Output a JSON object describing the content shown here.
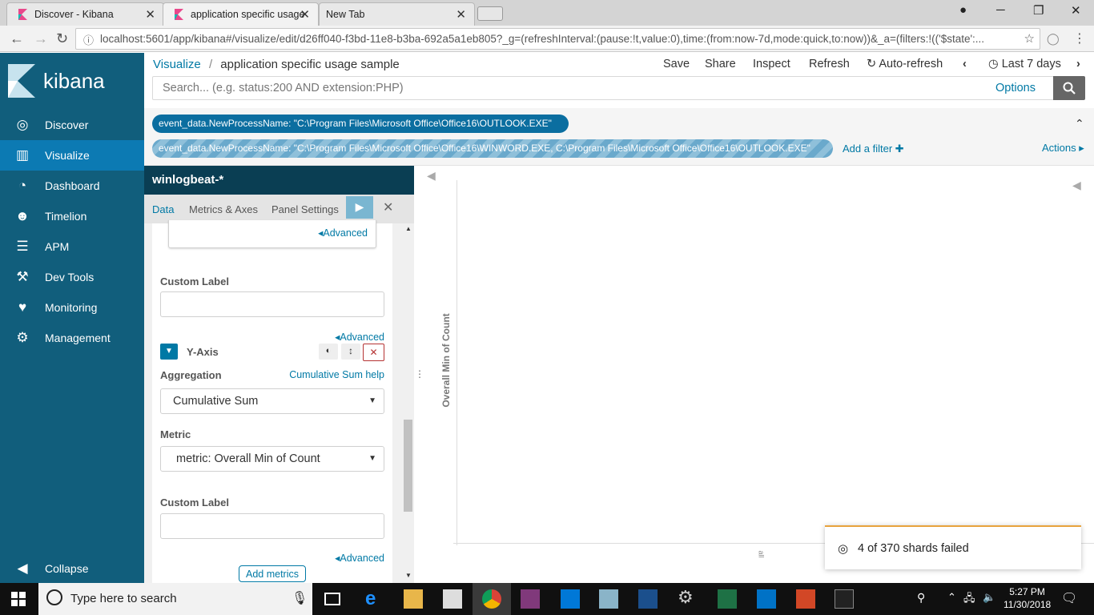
{
  "browser": {
    "tabs": [
      {
        "title": "Discover - Kibana"
      },
      {
        "title": "application specific usage"
      },
      {
        "title": "New Tab"
      }
    ],
    "url": "localhost:5601/app/kibana#/visualize/edit/d26ff040-f3bd-11e8-b3ba-692a5a1eb805?_g=(refreshInterval:(pause:!t,value:0),time:(from:now-7d,mode:quick,to:now))&_a=(filters:!(('$state':..."
  },
  "sidebar": {
    "logo": "kibana",
    "items": [
      {
        "label": "Discover",
        "icon": "compass-icon"
      },
      {
        "label": "Visualize",
        "icon": "bar-chart-icon",
        "active": true
      },
      {
        "label": "Dashboard",
        "icon": "dashboard-icon"
      },
      {
        "label": "Timelion",
        "icon": "timelion-icon"
      },
      {
        "label": "APM",
        "icon": "apm-icon"
      },
      {
        "label": "Dev Tools",
        "icon": "wrench-icon"
      },
      {
        "label": "Monitoring",
        "icon": "heartbeat-icon"
      },
      {
        "label": "Management",
        "icon": "gear-icon"
      }
    ],
    "collapse": "Collapse"
  },
  "header": {
    "crumb_link": "Visualize",
    "crumb_sep": "/",
    "crumb_title": "application specific usage sample",
    "save": "Save",
    "share": "Share",
    "inspect": "Inspect",
    "refresh": "Refresh",
    "auto_refresh": "Auto-refresh",
    "time": "Last 7 days"
  },
  "search": {
    "placeholder": "Search... (e.g. status:200 AND extension:PHP)",
    "options": "Options"
  },
  "filters": {
    "pill1": "event_data.NewProcessName: \"C:\\Program Files\\Microsoft Office\\Office16\\OUTLOOK.EXE\"",
    "pill2": "event_data.NewProcessName: \"C:\\Program Files\\Microsoft Office\\Office16\\WINWORD.EXE, C:\\Program Files\\Microsoft Office\\Office16\\OUTLOOK.EXE\"",
    "add": "Add a filter",
    "actions": "Actions"
  },
  "editor": {
    "index": "winlogbeat-*",
    "tabs": [
      "Data",
      "Metrics & Axes",
      "Panel Settings"
    ],
    "advanced": "Advanced",
    "custom_label": "Custom Label",
    "yaxis": "Y-Axis",
    "aggregation": "Aggregation",
    "agg_help": "Cumulative Sum help",
    "agg_value": "Cumulative Sum",
    "metric": "Metric",
    "metric_value": "metric: Overall Min of Count",
    "add_metrics": "Add metrics"
  },
  "chart": {
    "ytitle": "Overall Min of Count",
    "xtick": "all"
  },
  "toast": {
    "text": "4 of 370 shards failed"
  },
  "taskbar": {
    "search": "Type here to search",
    "time": "5:27 PM",
    "date": "11/30/2018"
  }
}
